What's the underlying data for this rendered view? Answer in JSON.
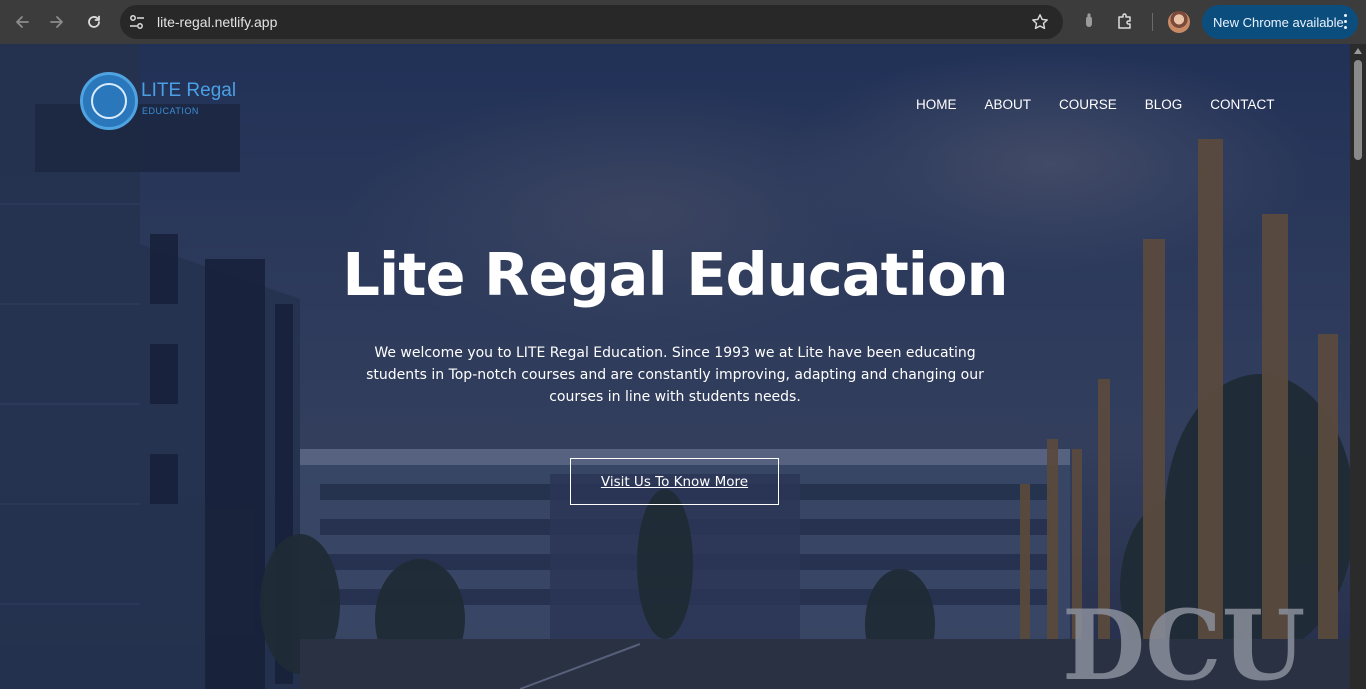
{
  "browser": {
    "url": "lite-regal.netlify.app",
    "update_label": "New Chrome available",
    "theme_color": "#3c3c3c",
    "update_color": "#0b4e7e",
    "icons": [
      "back-arrow-icon",
      "forward-arrow-icon",
      "reload-icon",
      "site-settings-icon",
      "bookmark-star-icon",
      "extension-icon",
      "puzzle-icon",
      "profile-avatar",
      "kebab-menu-icon"
    ]
  },
  "site": {
    "logo_title": "LITE Regal",
    "logo_subtitle": "EDUCATION",
    "logo_color": "#2a78bb",
    "nav": [
      {
        "label": "HOME"
      },
      {
        "label": "ABOUT"
      },
      {
        "label": "COURSE"
      },
      {
        "label": "BLOG"
      },
      {
        "label": "CONTACT"
      }
    ]
  },
  "hero": {
    "title": "Lite Regal Education",
    "text": "We welcome you to LITE Regal Education. Since 1993 we at Lite have been educating students in Top-notch courses and are constantly improving, adapting and changing our courses in line with students needs.",
    "cta_label": "Visit Us To Know More",
    "sign_text": "DCU"
  }
}
